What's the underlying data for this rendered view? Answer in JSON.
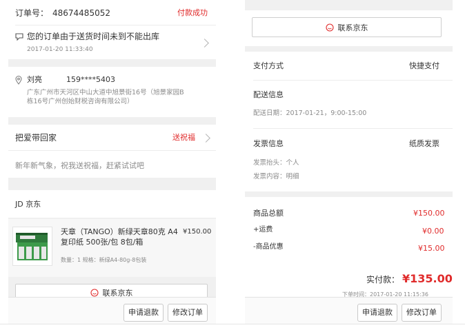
{
  "left": {
    "order": {
      "label": "订单号：",
      "number": "48674485052",
      "status": "付款成功"
    },
    "notice": {
      "text": "您的订单由于送货时间未到不能出库",
      "time": "2017-01-20 11:33:40"
    },
    "address": {
      "name": "刘亮",
      "phone": "159****5403",
      "line1": "广东广州市天河区中山大道中旭景街16号（旭景家园B",
      "line2": "栋16号广州创始财税咨询有限公司）"
    },
    "blessing": {
      "title": "把爱带回家",
      "action": "送祝福",
      "desc": "新年新气象，祝我送祝福，赶紧试试吧"
    },
    "shop": {
      "name": "JD 京东"
    },
    "product": {
      "title_line1": "天章（TANGO）新绿天章80克 A4",
      "title_line2": "复印纸 500张/包 8包/箱",
      "price": "¥150.00",
      "spec": "数量：1 规格：新绿A4-80g-8包装"
    },
    "contact_label": "联系京东",
    "buttons": {
      "refund": "申请退款",
      "modify": "修改订单"
    }
  },
  "right": {
    "contact_label": "联系京东",
    "payment": {
      "label": "支付方式",
      "value": "快捷支付"
    },
    "delivery": {
      "title": "配送信息",
      "date": "配送日期：2017-01-21，9:00-15:00"
    },
    "invoice": {
      "title": "发票信息",
      "type": "纸质发票",
      "header": "发票抬头：个人",
      "content": "发票内容：明细"
    },
    "summary": [
      {
        "label": "商品总额",
        "value": "¥150.00"
      },
      {
        "label": "+运费",
        "value": "¥0.00"
      },
      {
        "label": "-商品优惠",
        "value": "¥15.00"
      }
    ],
    "paid": {
      "label": "实付款：",
      "amount": "¥135.00"
    },
    "order_time": "下单时间：2017-01-20 11:15:36",
    "buttons": {
      "refund": "申请退款",
      "modify": "修改订单"
    }
  },
  "colors": {
    "accent": "#e02b2b",
    "page_bg": "#f0f0f0"
  }
}
